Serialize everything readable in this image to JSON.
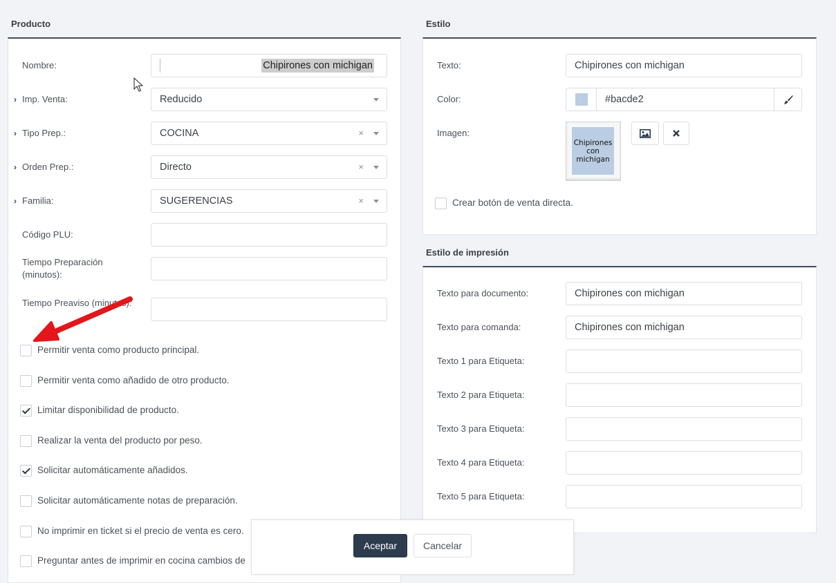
{
  "producto": {
    "title": "Producto",
    "fields": [
      {
        "label": "Nombre:",
        "value": "Chipirones con michigan",
        "type": "text",
        "chevron": false
      },
      {
        "label": "Imp. Venta:",
        "value": "Reducido",
        "type": "select",
        "chevron": true,
        "clear": false
      },
      {
        "label": "Tipo Prep.:",
        "value": "COCINA",
        "type": "select",
        "chevron": true,
        "clear": true
      },
      {
        "label": "Orden Prep.:",
        "value": "Directo",
        "type": "select",
        "chevron": true,
        "clear": true
      },
      {
        "label": "Familia:",
        "value": "SUGERENCIAS",
        "type": "select",
        "chevron": true,
        "clear": true
      },
      {
        "label": "Código PLU:",
        "value": "",
        "type": "text",
        "chevron": false
      },
      {
        "label": "Tiempo Preparación (minutos):",
        "value": "",
        "type": "text",
        "chevron": false
      },
      {
        "label": "Tiempo Preaviso (minutos):",
        "value": "",
        "type": "text",
        "chevron": false
      }
    ],
    "checkboxes": [
      {
        "label": "Permitir venta como producto principal.",
        "checked": false
      },
      {
        "label": "Permitir venta como añadido de otro producto.",
        "checked": false
      },
      {
        "label": "Limitar disponibilidad de producto.",
        "checked": true
      },
      {
        "label": "Realizar la venta del producto por peso.",
        "checked": false
      },
      {
        "label": "Solicitar automáticamente añadidos.",
        "checked": true
      },
      {
        "label": "Solicitar automáticamente notas de preparación.",
        "checked": false
      },
      {
        "label": "No imprimir en ticket si el precio de venta es cero.",
        "checked": false
      },
      {
        "label": "Preguntar antes de imprimir en cocina cambios de",
        "checked": false
      }
    ],
    "clear_symbol": "×"
  },
  "estilo": {
    "title": "Estilo",
    "texto_label": "Texto:",
    "texto_value": "Chipirones con michigan",
    "color_label": "Color:",
    "color_value": "#bacde2",
    "imagen_label": "Imagen:",
    "preview_text": "Chipirones con michigan",
    "direct_sale_label": "Crear botón de venta directa.",
    "direct_sale_checked": false
  },
  "impresion": {
    "title": "Estilo de impresión",
    "fields": [
      {
        "label": "Texto para documento:",
        "value": "Chipirones con michigan"
      },
      {
        "label": "Texto para comanda:",
        "value": "Chipirones con michigan"
      },
      {
        "label": "Texto 1 para Etiqueta:",
        "value": ""
      },
      {
        "label": "Texto 2 para Etiqueta:",
        "value": ""
      },
      {
        "label": "Texto 3 para Etiqueta:",
        "value": ""
      },
      {
        "label": "Texto 4 para Etiqueta:",
        "value": ""
      },
      {
        "label": "Texto 5 para Etiqueta:",
        "value": ""
      }
    ]
  },
  "dialog": {
    "accept_label": "Aceptar",
    "cancel_label": "Cancelar"
  },
  "colors": {
    "accent": "#2c3b4e",
    "swatch": "#bacde2",
    "arrow": "#e3161b"
  },
  "icons": [
    "chevron-right-icon",
    "caret-down-icon",
    "clear-icon",
    "brush-icon",
    "image-icon",
    "close-icon",
    "cursor-icon",
    "arrow-annotation-icon"
  ]
}
